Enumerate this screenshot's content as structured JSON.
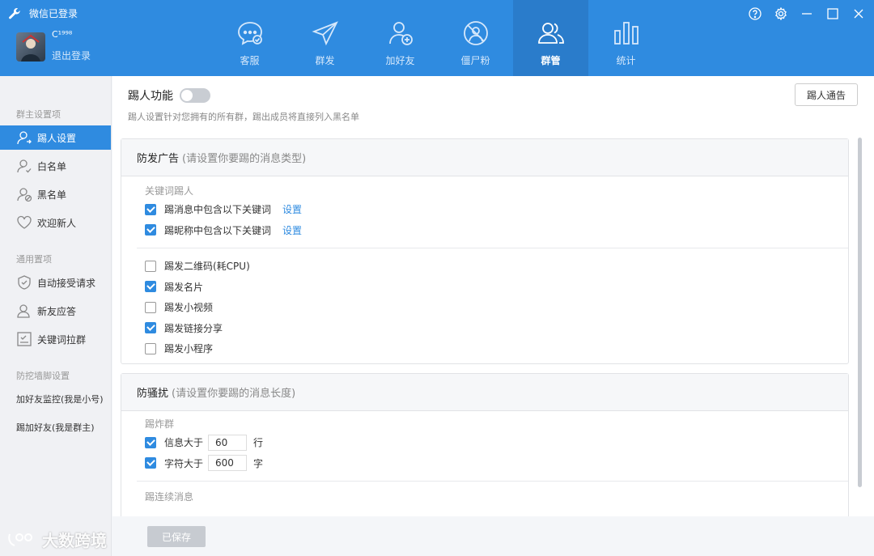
{
  "app": {
    "status": "微信已登录",
    "username": "C¹⁹⁹⁸",
    "logout": "退出登录"
  },
  "nav": [
    {
      "label": "客服",
      "icon": "chat-icon"
    },
    {
      "label": "群发",
      "icon": "send-icon"
    },
    {
      "label": "加好友",
      "icon": "add-friend-icon"
    },
    {
      "label": "僵尸粉",
      "icon": "zombie-icon"
    },
    {
      "label": "群管",
      "icon": "group-icon",
      "active": true
    },
    {
      "label": "统计",
      "icon": "stats-icon"
    }
  ],
  "sidebar": {
    "sections": [
      "群主设置项",
      "通用置项",
      "防挖墙脚设置"
    ],
    "items": [
      "踢人设置",
      "白名单",
      "黑名单",
      "欢迎新人",
      "自动接受请求",
      "新友应答",
      "关键词拉群",
      "加好友监控(我是小号)",
      "踢加好友(我是群主)"
    ]
  },
  "main": {
    "feature_title": "踢人功能",
    "feature_desc": "踢人设置针对您拥有的所有群，踢出成员将直接列入黑名单",
    "notice_button": "踢人通告",
    "ads": {
      "title": "防发广告",
      "hint": "(请设置你要踢的消息类型)",
      "keyword_label": "关键词踢人",
      "keyword_rows": [
        {
          "label": "踢消息中包含以下关键词",
          "checked": true,
          "link": "设置"
        },
        {
          "label": "踢昵称中包含以下关键词",
          "checked": true,
          "link": "设置"
        }
      ],
      "rows": [
        {
          "label": "踢发二维码(耗CPU)",
          "checked": false
        },
        {
          "label": "踢发名片",
          "checked": true
        },
        {
          "label": "踢发小视频",
          "checked": false
        },
        {
          "label": "踢发链接分享",
          "checked": true
        },
        {
          "label": "踢发小程序",
          "checked": false
        }
      ]
    },
    "spam": {
      "title": "防骚扰",
      "hint": "(请设置你要踢的消息长度)",
      "bomb_label": "踢炸群",
      "rows": [
        {
          "label": "信息大于",
          "value": "60",
          "unit": "行",
          "checked": true
        },
        {
          "label": "字符大于",
          "value": "600",
          "unit": "字",
          "checked": true
        }
      ],
      "consecutive_label": "踢连续消息"
    }
  },
  "footer": {
    "save": "已保存",
    "watermark": "大数跨境"
  },
  "colors": {
    "primary": "#2f8be0",
    "nav_active": "#2a7ccb"
  }
}
